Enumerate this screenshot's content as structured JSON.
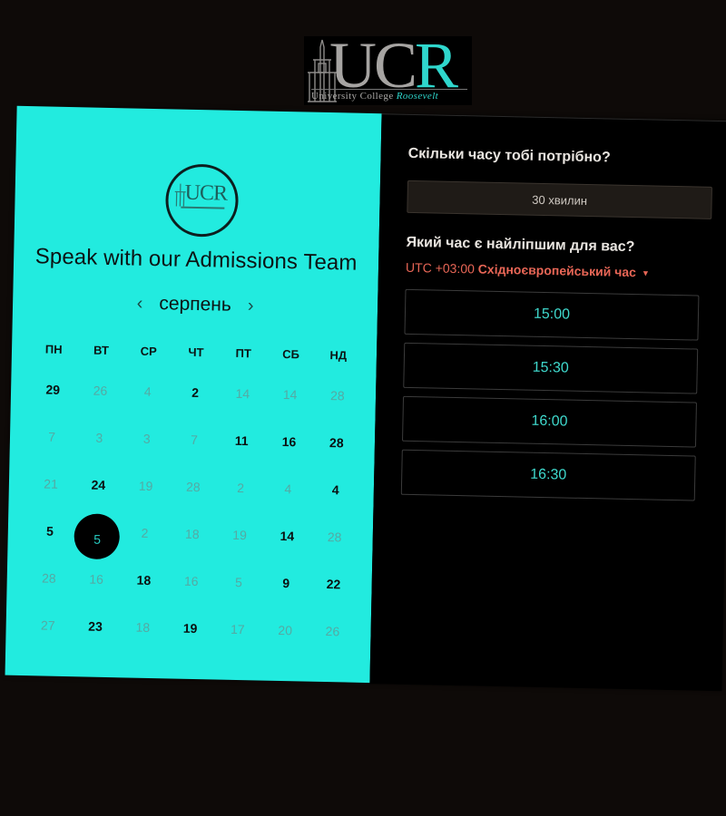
{
  "logo": {
    "letters_uc": "UC",
    "letters_r": "R",
    "subtitle_main": "University College",
    "subtitle_accent": "Roosevelt",
    "colors": {
      "grey": "#a6a4a2",
      "teal": "#2fd7cd"
    }
  },
  "booking": {
    "title": "Speak with our Admissions Team",
    "month": "серпень",
    "prev_icon": "chevron-left-icon",
    "next_icon": "chevron-right-icon",
    "weekdays": [
      "ПН",
      "ВТ",
      "СР",
      "ЧТ",
      "ПТ",
      "СБ",
      "НД"
    ],
    "weeks": [
      [
        {
          "d": "29",
          "a": true
        },
        {
          "d": "26",
          "a": false
        },
        {
          "d": "4",
          "a": false
        },
        {
          "d": "2",
          "a": true
        },
        {
          "d": "14",
          "a": false
        },
        {
          "d": "14",
          "a": false
        },
        {
          "d": "28",
          "a": false
        }
      ],
      [
        {
          "d": "7",
          "a": false
        },
        {
          "d": "3",
          "a": false
        },
        {
          "d": "3",
          "a": false
        },
        {
          "d": "7",
          "a": false
        },
        {
          "d": "11",
          "a": true
        },
        {
          "d": "16",
          "a": true
        },
        {
          "d": "28",
          "a": true
        }
      ],
      [
        {
          "d": "21",
          "a": false
        },
        {
          "d": "24",
          "a": true
        },
        {
          "d": "19",
          "a": false
        },
        {
          "d": "28",
          "a": false
        },
        {
          "d": "2",
          "a": false
        },
        {
          "d": "4",
          "a": false
        },
        {
          "d": "4",
          "a": true
        }
      ],
      [
        {
          "d": "5",
          "a": true
        },
        {
          "d": "5",
          "a": true,
          "s": true
        },
        {
          "d": "2",
          "a": false
        },
        {
          "d": "18",
          "a": false
        },
        {
          "d": "19",
          "a": false
        },
        {
          "d": "14",
          "a": true
        },
        {
          "d": "28",
          "a": false
        }
      ],
      [
        {
          "d": "28",
          "a": false
        },
        {
          "d": "16",
          "a": false
        },
        {
          "d": "18",
          "a": true
        },
        {
          "d": "16",
          "a": false
        },
        {
          "d": "5",
          "a": false
        },
        {
          "d": "9",
          "a": true
        },
        {
          "d": "22",
          "a": true
        }
      ],
      [
        {
          "d": "27",
          "a": false
        },
        {
          "d": "23",
          "a": true
        },
        {
          "d": "18",
          "a": false
        },
        {
          "d": "19",
          "a": true
        },
        {
          "d": "17",
          "a": false
        },
        {
          "d": "20",
          "a": false
        },
        {
          "d": "26",
          "a": false
        }
      ]
    ],
    "colors": {
      "panel": "#22ebdf",
      "selected": "#000000",
      "muted": "#55a9a3"
    }
  },
  "scheduler": {
    "duration_question": "Скільки часу тобі потрібно?",
    "duration_value": "30 хвилин",
    "time_question": "Який час є найліпшим для вас?",
    "tz_offset": "UTC +03:00",
    "tz_name": "Східноєвропейський час",
    "tz_icon": "caret-down-icon",
    "slots": [
      "15:00",
      "15:30",
      "16:00",
      "16:30"
    ],
    "colors": {
      "accent": "#e86656",
      "slot_text": "#3fd9cd"
    }
  }
}
